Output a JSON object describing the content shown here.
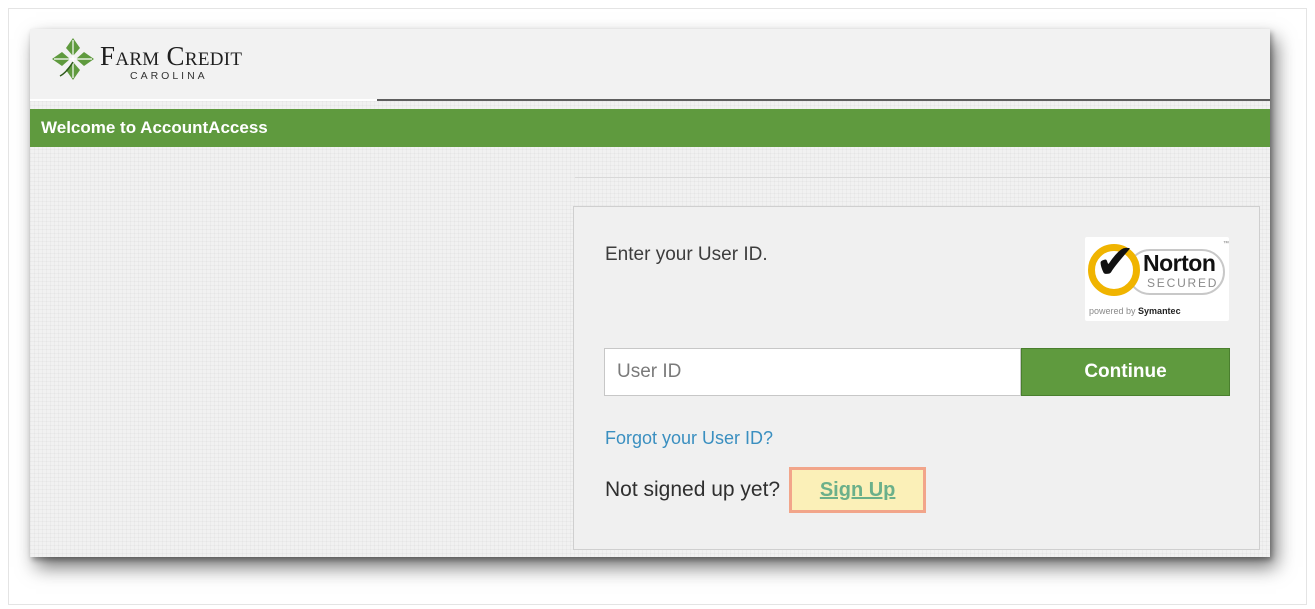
{
  "brand": {
    "name": "Farm Credit",
    "region": "CAROLINA",
    "accent": "#5f9a3e",
    "logo_icon": "leaf-diamond-icon"
  },
  "header": {
    "title": "Welcome to AccountAccess"
  },
  "login": {
    "prompt": "Enter your User ID.",
    "user_id": {
      "value": "",
      "placeholder": "User ID"
    },
    "continue_label": "Continue",
    "forgot_label": "Forgot your User ID?",
    "signup_prompt": "Not signed up yet?",
    "signup_label": "Sign Up"
  },
  "norton_badge": {
    "name": "Norton",
    "secured": "SECURED",
    "powered_prefix": "powered by",
    "powered_brand": "Symantec",
    "trademark": "™",
    "icon": "checkmark-icon"
  }
}
